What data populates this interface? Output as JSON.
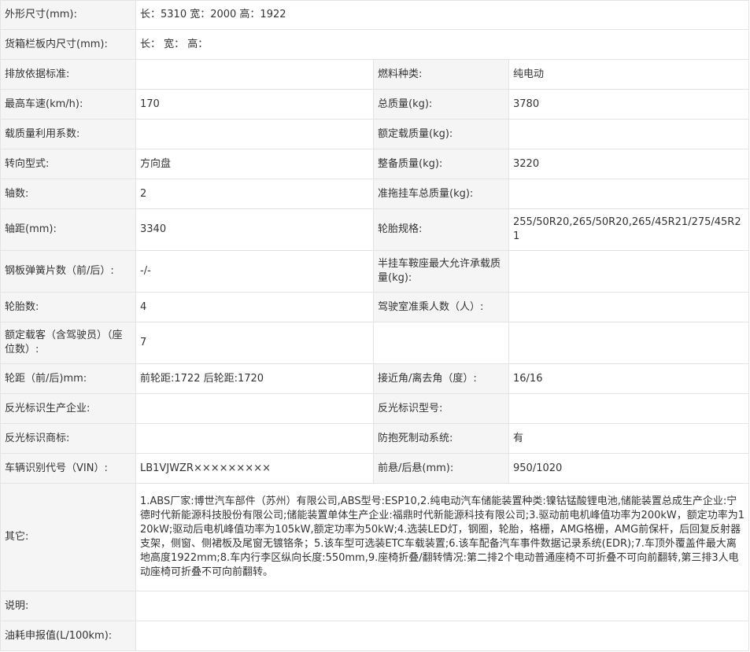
{
  "rows": [
    {
      "type": "wide",
      "label": "外形尺寸(mm):",
      "value": "长：5310 宽：2000 高：1922"
    },
    {
      "type": "wide",
      "label": "货箱栏板内尺寸(mm):",
      "value": "长：  宽：  高："
    },
    {
      "type": "pair",
      "l1": "排放依据标准:",
      "v1": "",
      "l2": "燃料种类:",
      "v2": "纯电动"
    },
    {
      "type": "pair",
      "l1": "最高车速(km/h):",
      "v1": "170",
      "l2": "总质量(kg):",
      "v2": "3780"
    },
    {
      "type": "pair",
      "l1": "载质量利用系数:",
      "v1": "",
      "l2": "额定载质量(kg):",
      "v2": ""
    },
    {
      "type": "pair",
      "l1": "转向型式:",
      "v1": "方向盘",
      "l2": "整备质量(kg):",
      "v2": "3220"
    },
    {
      "type": "pair",
      "l1": "轴数:",
      "v1": "2",
      "l2": "准拖挂车总质量(kg):",
      "v2": ""
    },
    {
      "type": "pair",
      "l1": "轴距(mm):",
      "v1": "3340",
      "l2": "轮胎规格:",
      "v2": "255/50R20,265/50R20,265/45R21/275/45R21"
    },
    {
      "type": "pair",
      "l1": "钢板弹簧片数（前/后）:",
      "v1": "-/-",
      "l2": "半挂车鞍座最大允许承载质量(kg):",
      "v2": ""
    },
    {
      "type": "pair",
      "l1": "轮胎数:",
      "v1": "4",
      "l2": "驾驶室准乘人数（人）:",
      "v2": ""
    },
    {
      "type": "pair",
      "l1": "额定载客（含驾驶员）（座位数）:",
      "v1": "7",
      "l2": "",
      "v2": ""
    },
    {
      "type": "pair",
      "l1": "轮距（前/后)mm:",
      "v1": "前轮距:1722 后轮距:1720",
      "l2": "接近角/离去角（度）:",
      "v2": "16/16"
    },
    {
      "type": "pair",
      "l1": "反光标识生产企业:",
      "v1": "",
      "l2": "反光标识型号:",
      "v2": ""
    },
    {
      "type": "pair",
      "l1": "反光标识商标:",
      "v1": "",
      "l2": "防抱死制动系统:",
      "v2": "有"
    },
    {
      "type": "pair",
      "l1": "车辆识别代号（VIN）:",
      "v1": "LB1VJWZR×××××××××",
      "l2": "前悬/后悬(mm):",
      "v2": "950/1020"
    },
    {
      "type": "wide",
      "label": "其它:",
      "value": "1.ABS厂家:博世汽车部件（苏州）有限公司,ABS型号:ESP10,2.纯电动汽车储能装置种类:镍钴锰酸锂电池,储能装置总成生产企业:宁德时代新能源科技股份有限公司;储能装置单体生产企业:福鼎时代新能源科技有限公司;3.驱动前电机峰值功率为200kW，额定功率为120kW;驱动后电机峰值功率为105kW,额定功率为50kW;4.选装LED灯，钢圈，轮胎，格栅，AMG格栅，AMG前保杆，后回复反射器支架，侧窗、侧裙板及尾窗无镀铬条；5.该车型可选装ETC车载装置;6.该车配备汽车事件数据记录系统(EDR);7.车顶外覆盖件最大离地高度1922mm;8.车内行李区纵向长度:550mm,9.座椅折叠/翻转情况:第二排2个电动普通座椅不可折叠不可向前翻转,第三排3人电动座椅可折叠不可向前翻转。"
    },
    {
      "type": "wide",
      "label": "说明:",
      "value": ""
    },
    {
      "type": "wide",
      "label": "油耗申报值(L/100km):",
      "value": ""
    }
  ]
}
